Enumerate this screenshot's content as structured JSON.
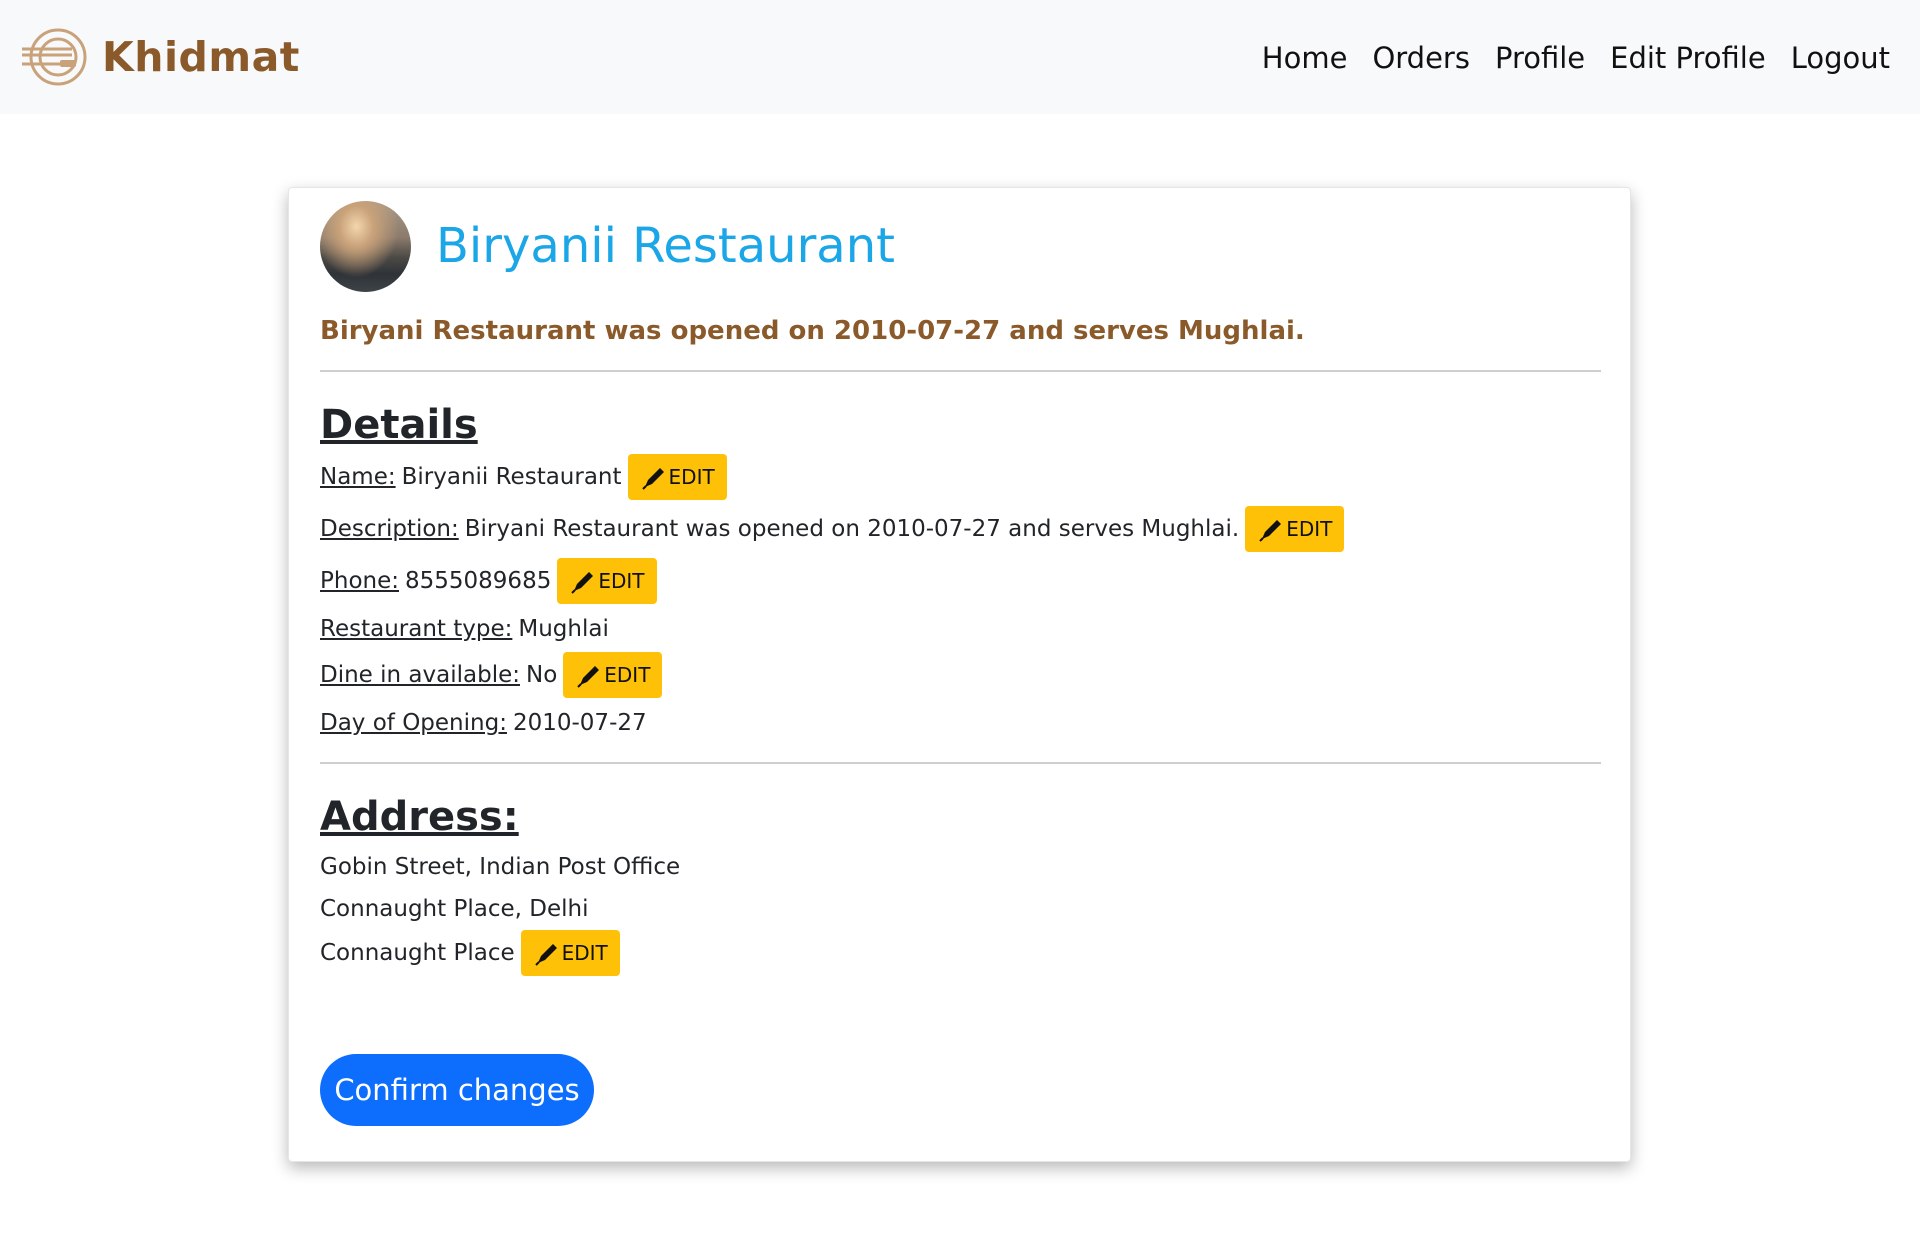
{
  "navbar": {
    "brand": "Khidmat",
    "links": [
      "Home",
      "Orders",
      "Profile",
      "Edit Profile",
      "Logout"
    ]
  },
  "restaurant": {
    "title": "Biryanii Restaurant",
    "tagline": "Biryani Restaurant was opened on 2010-07-27 and serves Mughlai."
  },
  "details": {
    "heading": "Details",
    "name_label": "Name:",
    "name_value": "Biryanii Restaurant",
    "description_label": "Description:",
    "description_value": "Biryani Restaurant was opened on 2010-07-27 and serves Mughlai.",
    "phone_label": "Phone:",
    "phone_value": "8555089685",
    "type_label": "Restaurant type:",
    "type_value": "Mughlai",
    "dine_label": "Dine in available:",
    "dine_value": "No",
    "opening_label": "Day of Opening:",
    "opening_value": "2010-07-27"
  },
  "address": {
    "heading": "Address:",
    "line1": "Gobin Street, Indian Post Office",
    "line2": "Connaught Place, Delhi",
    "line3": "Connaught Place"
  },
  "edit_label": "EDIT",
  "confirm_label": "Confirm changes",
  "colors": {
    "brand": "#8b5a2b",
    "title": "#1ba6e8",
    "edit_button": "#ffc107",
    "confirm_button": "#0d6efd"
  },
  "icons": {
    "logo": "plate-fork-knife-logo",
    "edit": "pen-icon"
  }
}
